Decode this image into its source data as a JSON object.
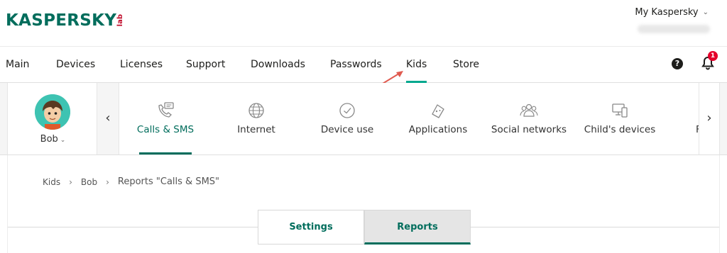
{
  "header": {
    "logo_text": "KASPERSKY",
    "logo_suffix": "lab",
    "account_label": "My Kaspersky"
  },
  "nav": {
    "items": [
      {
        "label": "Main"
      },
      {
        "label": "Devices"
      },
      {
        "label": "Licenses"
      },
      {
        "label": "Support"
      },
      {
        "label": "Downloads"
      },
      {
        "label": "Passwords"
      },
      {
        "label": "Kids",
        "active": true
      },
      {
        "label": "Store"
      }
    ],
    "help_icon": "?",
    "notifications_count": "1"
  },
  "profile": {
    "name": "Bob"
  },
  "categories": [
    {
      "label": "Calls & SMS",
      "icon": "phone-chat-icon",
      "active": true
    },
    {
      "label": "Internet",
      "icon": "globe-icon"
    },
    {
      "label": "Device use",
      "icon": "clock-icon"
    },
    {
      "label": "Applications",
      "icon": "gamepad-icon"
    },
    {
      "label": "Social networks",
      "icon": "people-icon"
    },
    {
      "label": "Child's devices",
      "icon": "devices-icon"
    }
  ],
  "breadcrumb": {
    "items": [
      "Kids",
      "Bob",
      "Reports \"Calls & SMS\""
    ]
  },
  "tabs": {
    "settings": "Settings",
    "reports": "Reports"
  },
  "colors": {
    "brand": "#006d5c",
    "accent": "#00a88e",
    "badge": "#e4002b",
    "annotation_arrow": "#e05a4f"
  }
}
